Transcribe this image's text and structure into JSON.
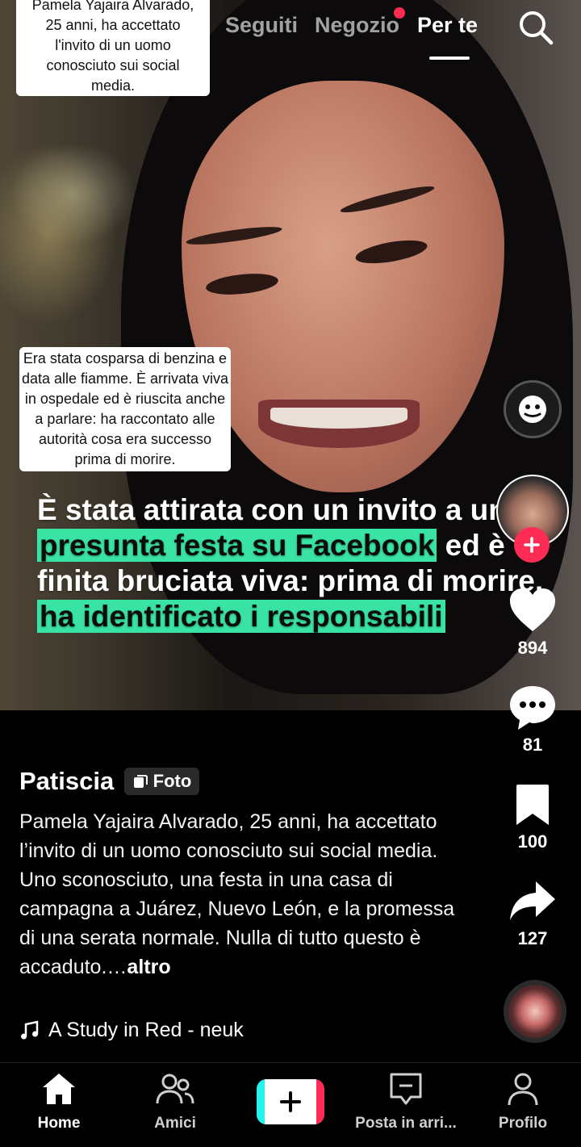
{
  "top_nav": {
    "tabs": [
      {
        "label": "Seguiti"
      },
      {
        "label": "Negozio"
      },
      {
        "label": "Per te"
      }
    ]
  },
  "post": {
    "sticker_top_lines": [
      "Pamela Yajaira Alvarado,",
      "25 anni, ha accettato",
      "l'invito di un uomo",
      "conosciuto sui social",
      "media."
    ],
    "sticker_mid": "Era stata cosparsa di benzina e data alle fiamme. È arrivata viva in ospedale ed è riuscita anche a parlare: ha raccontato alle autorità cosa era successo prima di morire.",
    "headline_parts": {
      "p1": "È stata attirata con un invito a una ",
      "h1": "presunta festa su Facebook",
      "p2": " ed è finita bruciata viva: prima di morire, ",
      "h2": "ha identificato i responsabili"
    }
  },
  "rail": {
    "likes": "894",
    "comments": "81",
    "saves": "100",
    "shares": "127"
  },
  "caption": {
    "author": "Patiscia",
    "tag": "Foto",
    "text": "Pamela Yajaira Alvarado, 25 anni, ha accettato l’invito di un uomo conosciuto sui social media. Uno sconosciuto, una festa in una casa di campagna a Juárez, Nuevo León, e la promessa di una serata normale. Nulla di tutto questo è accaduto.…",
    "more": "altro",
    "music": "A Study in Red - neuk"
  },
  "bottom_nav": {
    "home": "Home",
    "friends": "Amici",
    "inbox": "Posta in arri...",
    "profile": "Profilo"
  },
  "colors": {
    "highlight": "#39e3a4",
    "accent_red": "#fe2c55",
    "accent_cyan": "#25f4ee"
  }
}
